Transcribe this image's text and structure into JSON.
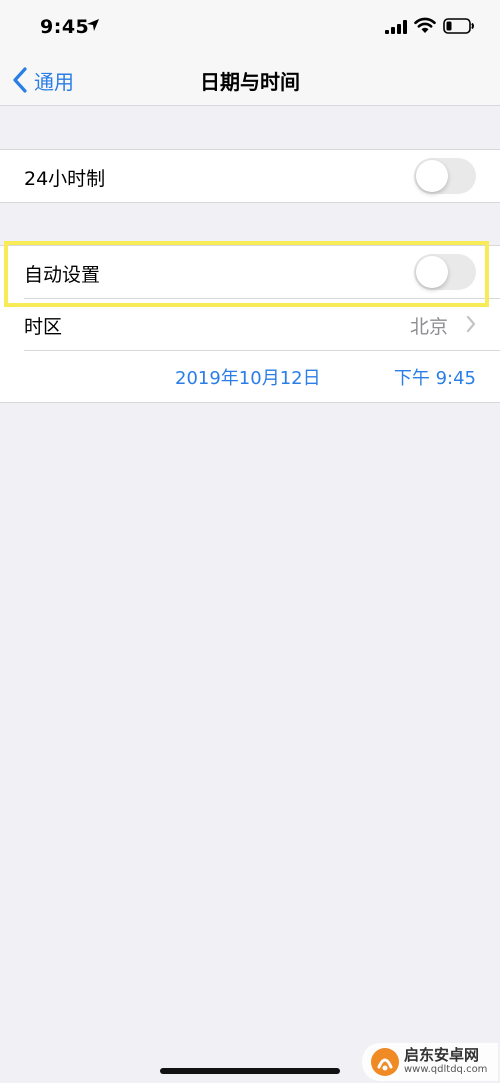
{
  "status_bar": {
    "time": "9:45"
  },
  "nav": {
    "back_label": "通用",
    "title": "日期与时间"
  },
  "settings": {
    "hour24": {
      "label": "24小时制",
      "enabled": false
    },
    "auto_set": {
      "label": "自动设置",
      "enabled": false
    },
    "timezone": {
      "label": "时区",
      "value": "北京"
    },
    "datetime": {
      "date": "2019年10月12日",
      "time": "下午 9:45"
    }
  },
  "watermark": {
    "name": "启东安卓网",
    "url": "www.qdltdq.com"
  },
  "colors": {
    "accent": "#2a7ee6",
    "highlight": "#f7ec57",
    "background": "#f0f0f5"
  }
}
